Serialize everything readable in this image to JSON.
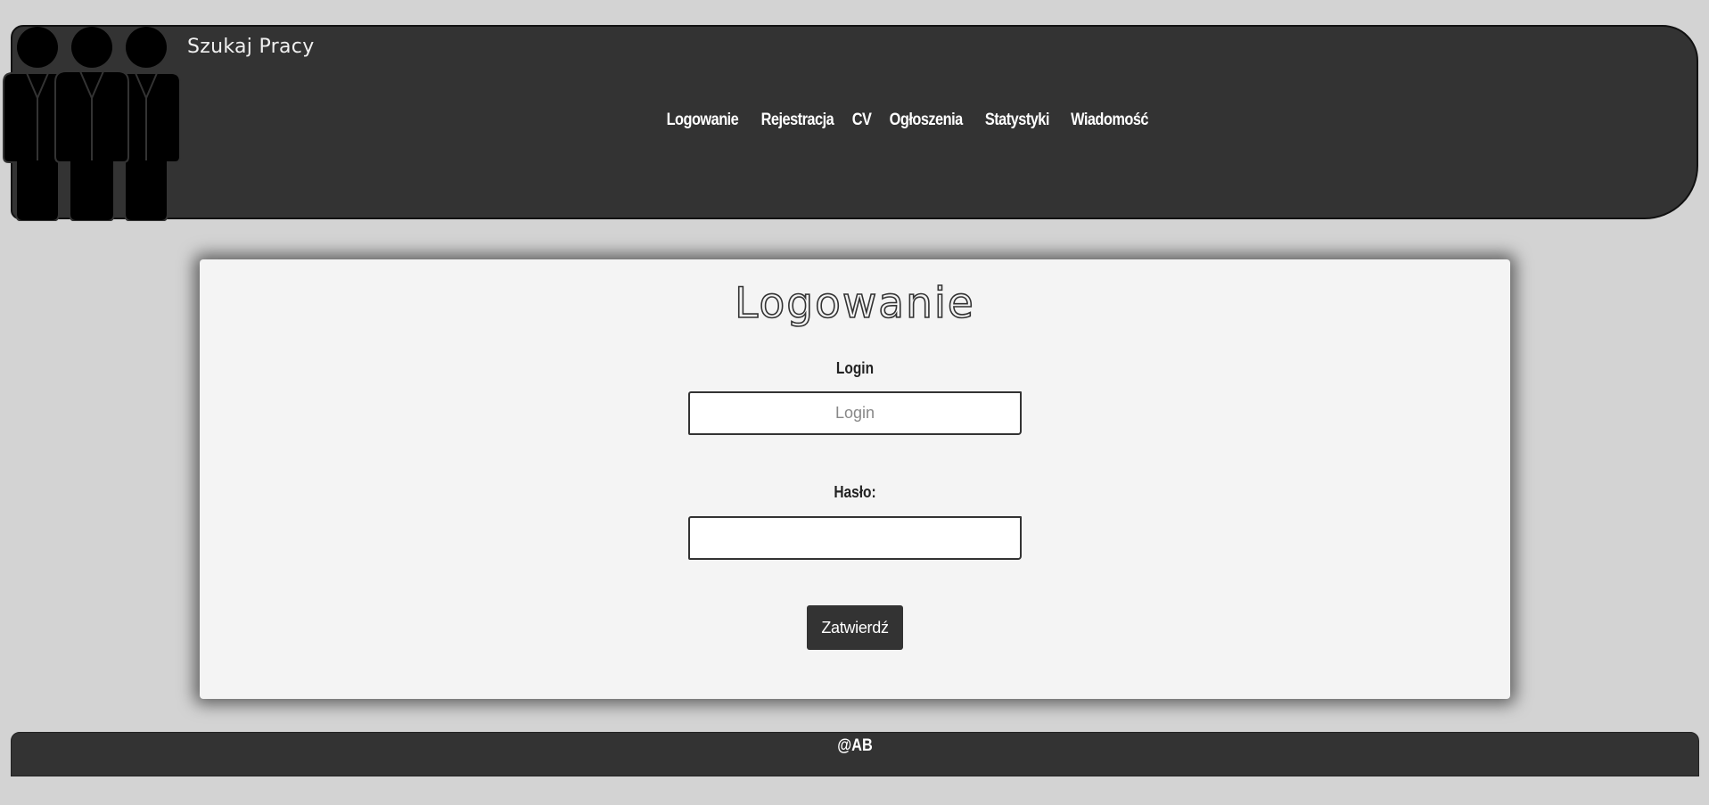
{
  "header": {
    "site_title": "Szukaj Pracy",
    "logo_icon": "people-group-icon",
    "nav": [
      {
        "label": "Logowanie"
      },
      {
        "label": "Rejestracja"
      },
      {
        "label": "CV"
      },
      {
        "label": "Ogłoszenia"
      },
      {
        "label": "Statystyki"
      },
      {
        "label": "Wiadomość"
      }
    ]
  },
  "login_form": {
    "title": "Logowanie",
    "login_label": "Login",
    "login_placeholder": "Login",
    "login_value": "",
    "password_label": "Hasło:",
    "password_value": "",
    "submit_label": "Zatwierdź"
  },
  "footer": {
    "text": "@AB"
  },
  "colors": {
    "page_background": "#d3d3d3",
    "header_background": "#333333",
    "card_background": "#f4f4f4",
    "button_background": "#333333"
  }
}
